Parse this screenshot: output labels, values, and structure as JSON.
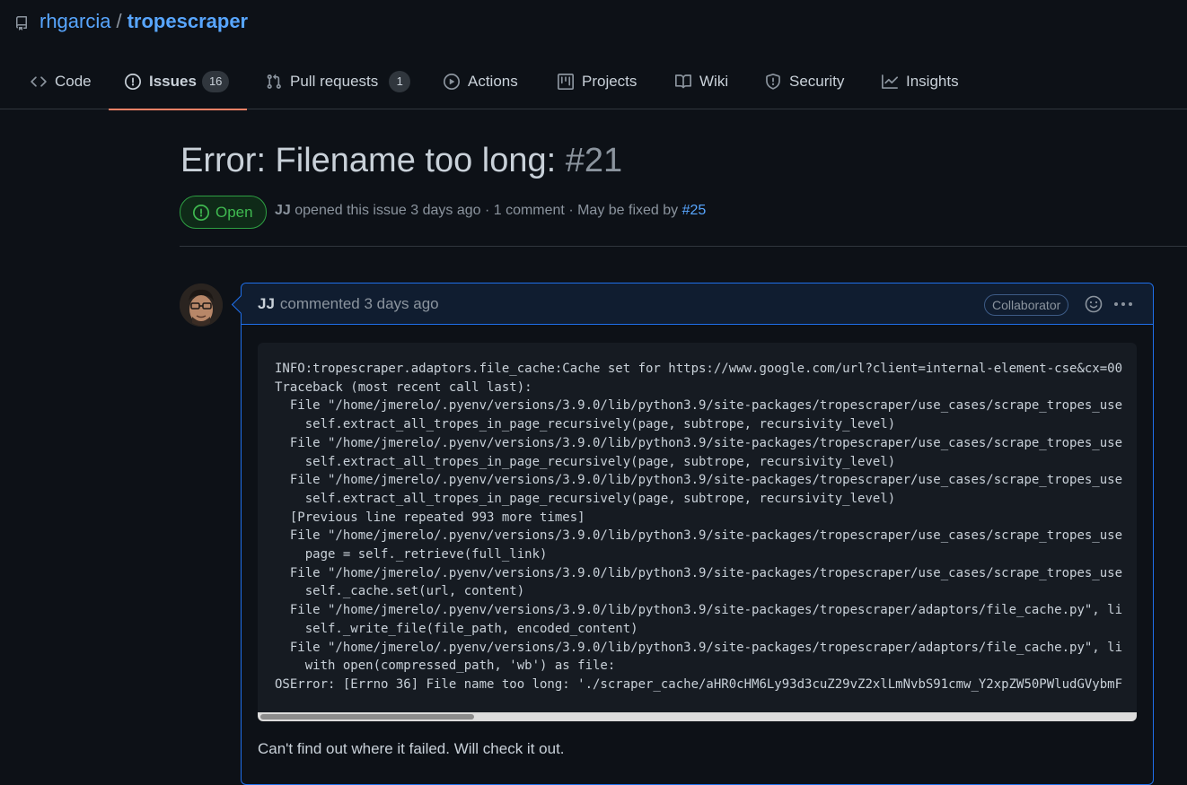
{
  "repo": {
    "owner": "rhgarcia",
    "separator": "/",
    "name": "tropescraper",
    "icon": "repo-icon"
  },
  "tabs": [
    {
      "label": "Code",
      "icon": "code-icon"
    },
    {
      "label": "Issues",
      "icon": "issue-opened-icon",
      "count": "16",
      "selected": true
    },
    {
      "label": "Pull requests",
      "icon": "git-pull-request-icon",
      "count": "1"
    },
    {
      "label": "Actions",
      "icon": "play-icon"
    },
    {
      "label": "Projects",
      "icon": "table-icon"
    },
    {
      "label": "Wiki",
      "icon": "book-icon"
    },
    {
      "label": "Security",
      "icon": "shield-icon"
    },
    {
      "label": "Insights",
      "icon": "graph-icon"
    }
  ],
  "issue": {
    "title": "Error: Filename too long:",
    "number": "#21",
    "state": "Open",
    "author": "JJ",
    "opened_text": "opened this issue 3 days ago · 1 comment · May be fixed by",
    "fixed_by": "#25"
  },
  "comment": {
    "author": "JJ",
    "action_text": "commented 3 days ago",
    "role_badge": "Collaborator",
    "code_lines": [
      "INFO:tropescraper.adaptors.file_cache:Cache set for https://www.google.com/url?client=internal-element-cse&cx=00",
      "Traceback (most recent call last):",
      "  File \"/home/jmerelo/.pyenv/versions/3.9.0/lib/python3.9/site-packages/tropescraper/use_cases/scrape_tropes_use",
      "    self.extract_all_tropes_in_page_recursively(page, subtrope, recursivity_level)",
      "  File \"/home/jmerelo/.pyenv/versions/3.9.0/lib/python3.9/site-packages/tropescraper/use_cases/scrape_tropes_use",
      "    self.extract_all_tropes_in_page_recursively(page, subtrope, recursivity_level)",
      "  File \"/home/jmerelo/.pyenv/versions/3.9.0/lib/python3.9/site-packages/tropescraper/use_cases/scrape_tropes_use",
      "    self.extract_all_tropes_in_page_recursively(page, subtrope, recursivity_level)",
      "  [Previous line repeated 993 more times]",
      "  File \"/home/jmerelo/.pyenv/versions/3.9.0/lib/python3.9/site-packages/tropescraper/use_cases/scrape_tropes_use",
      "    page = self._retrieve(full_link)",
      "  File \"/home/jmerelo/.pyenv/versions/3.9.0/lib/python3.9/site-packages/tropescraper/use_cases/scrape_tropes_use",
      "    self._cache.set(url, content)",
      "  File \"/home/jmerelo/.pyenv/versions/3.9.0/lib/python3.9/site-packages/tropescraper/adaptors/file_cache.py\", li",
      "    self._write_file(file_path, encoded_content)",
      "  File \"/home/jmerelo/.pyenv/versions/3.9.0/lib/python3.9/site-packages/tropescraper/adaptors/file_cache.py\", li",
      "    with open(compressed_path, 'wb') as file:",
      "OSError: [Errno 36] File name too long: './scraper_cache/aHR0cHM6Ly93d3cuZ29vZ2xlLmNvbS91cmw_Y2xpZW50PWludGVybmF"
    ],
    "body": "Can't find out where it failed. Will check it out."
  },
  "colors": {
    "background": "#0d1117",
    "link": "#58a6ff",
    "open_green": "#3fb950",
    "tab_underline": "#f78166",
    "comment_border": "#1f6feb"
  }
}
